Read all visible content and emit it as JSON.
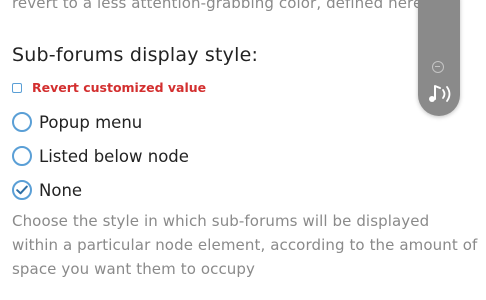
{
  "top_description": "revert to a less attention-grabbing color, defined here",
  "section": {
    "title": "Sub-forums display style:",
    "revert_label": "Revert customized value"
  },
  "options": [
    {
      "label": "Popup menu",
      "selected": false
    },
    {
      "label": "Listed below node",
      "selected": false
    },
    {
      "label": "None",
      "selected": true
    }
  ],
  "help_text": "Choose the style in which sub-forums will be displayed within a particular node element, according to the amount of space you want them to occupy",
  "overlay": {
    "icons": [
      "minus-circle-icon",
      "music-note-icon"
    ]
  },
  "colors": {
    "accent": "#5a9fd6",
    "revert": "#d32f2f",
    "muted_text": "#8a8a8a",
    "overlay_bg": "#8a8a8a"
  }
}
